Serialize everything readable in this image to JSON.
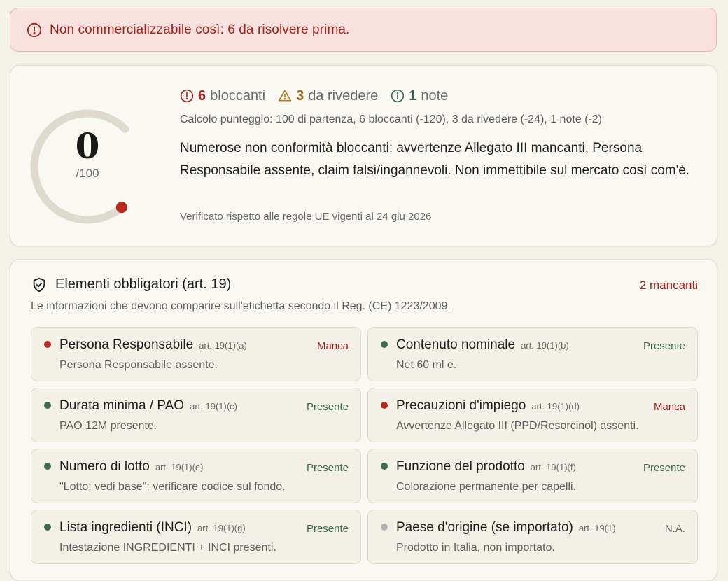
{
  "alert": {
    "text": "Non commercializzabile così: 6 da risolvere prima."
  },
  "score": {
    "value": "0",
    "max": "/100",
    "fraction": 0
  },
  "counts": {
    "blocking_num": "6",
    "blocking_label": "bloccanti",
    "review_num": "3",
    "review_label": "da rivedere",
    "notes_num": "1",
    "notes_label": "note"
  },
  "calculation": "Calcolo punteggio: 100 di partenza, 6 bloccanti (-120), 3 da rivedere (-24), 1 note (-2)",
  "summary": "Numerose non conformità bloccanti: avvertenze Allegato III mancanti, Persona Responsabile assente, claim falsi/ingannevoli. Non immettibile sul mercato così com'è.",
  "verified": "Verificato rispetto alle regole UE vigenti al 24 giu 2026",
  "colors": {
    "danger": "#a3241b",
    "warning": "#9a6a12",
    "ok": "#3d6b55",
    "track": "#dedad0"
  },
  "elements": {
    "title": "Elementi obbligatori (art. 19)",
    "missing_count": "2 mancanti",
    "description": "Le informazioni che devono comparire sull'etichetta secondo il Reg. (CE) 1223/2009.",
    "items": [
      {
        "name": "Persona Responsabile",
        "ref": "art. 19(1)(a)",
        "status": "Manca",
        "state": "missing",
        "detail": "Persona Responsabile assente."
      },
      {
        "name": "Contenuto nominale",
        "ref": "art. 19(1)(b)",
        "status": "Presente",
        "state": "present",
        "detail": "Net 60 ml e."
      },
      {
        "name": "Durata minima / PAO",
        "ref": "art. 19(1)(c)",
        "status": "Presente",
        "state": "present",
        "detail": "PAO 12M presente."
      },
      {
        "name": "Precauzioni d'impiego",
        "ref": "art. 19(1)(d)",
        "status": "Manca",
        "state": "missing",
        "detail": "Avvertenze Allegato III (PPD/Resorcinol) assenti."
      },
      {
        "name": "Numero di lotto",
        "ref": "art. 19(1)(e)",
        "status": "Presente",
        "state": "present",
        "detail": "\"Lotto: vedi base\"; verificare codice sul fondo."
      },
      {
        "name": "Funzione del prodotto",
        "ref": "art. 19(1)(f)",
        "status": "Presente",
        "state": "present",
        "detail": "Colorazione permanente per capelli."
      },
      {
        "name": "Lista ingredienti (INCI)",
        "ref": "art. 19(1)(g)",
        "status": "Presente",
        "state": "present",
        "detail": "Intestazione INGREDIENTI + INCI presenti."
      },
      {
        "name": "Paese d'origine (se importato)",
        "ref": "art. 19(1)",
        "status": "N.A.",
        "state": "na",
        "detail": "Prodotto in Italia, non importato."
      }
    ]
  }
}
